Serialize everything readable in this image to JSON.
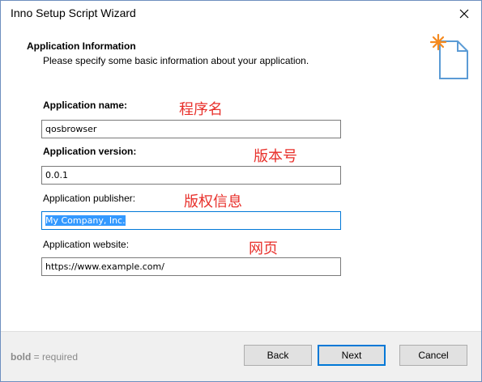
{
  "window": {
    "title": "Inno Setup Script Wizard"
  },
  "header": {
    "title": "Application Information",
    "subtitle": "Please specify some basic information about your application.",
    "icon": "wizard-document-sparkle-icon"
  },
  "form": {
    "name": {
      "label": "Application name:",
      "value": "qosbrowser",
      "required": true
    },
    "version": {
      "label": "Application version:",
      "value": "0.0.1",
      "required": true
    },
    "publisher": {
      "label": "Application publisher:",
      "value": "My Company, Inc.",
      "selected": true
    },
    "website": {
      "label": "Application website:",
      "value": "https://www.example.com/"
    }
  },
  "annotations": {
    "name": "程序名",
    "version": "版本号",
    "publisher": "版权信息",
    "website": "网页",
    "color": "#e8302b"
  },
  "footer": {
    "note_bold": "bold",
    "note_rest": " = required",
    "back": "Back",
    "next": "Next",
    "cancel": "Cancel"
  },
  "colors": {
    "accent": "#0078d7",
    "selection": "#3399ff",
    "icon_sparkle": "#f58a1f",
    "icon_outline": "#5b9bd5"
  }
}
